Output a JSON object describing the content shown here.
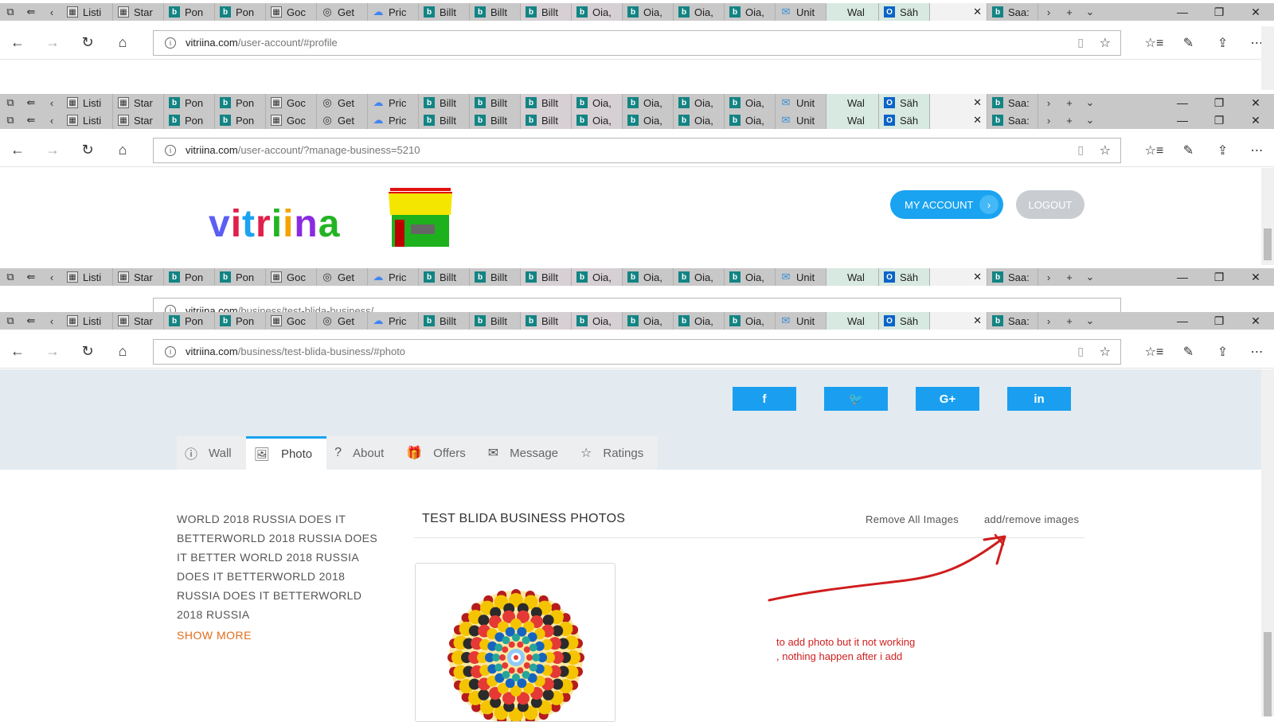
{
  "tabs": [
    {
      "label": "Listi",
      "icon": "tab-list-icon",
      "fav": "grid"
    },
    {
      "label": "Star",
      "icon": "start-page-icon",
      "fav": "grid"
    },
    {
      "label": "Pon",
      "icon": "bing-icon",
      "fav": "bing"
    },
    {
      "label": "Pon",
      "icon": "bing-icon",
      "fav": "bing"
    },
    {
      "label": "Goc",
      "icon": "apps-grid-icon",
      "fav": "grid"
    },
    {
      "label": "Get",
      "icon": "get-icon",
      "fav": "get"
    },
    {
      "label": "Pric",
      "icon": "google-cloud-icon",
      "fav": "gcloud"
    },
    {
      "label": "Billt",
      "icon": "bing-icon",
      "fav": "bing"
    },
    {
      "label": "Billt",
      "icon": "bing-icon",
      "fav": "bing"
    },
    {
      "label": "Billt",
      "icon": "bing-icon",
      "fav": "bing"
    },
    {
      "label": "Oia,",
      "icon": "bing-icon",
      "fav": "bing"
    },
    {
      "label": "Oia,",
      "icon": "bing-icon",
      "fav": "bing"
    },
    {
      "label": "Oia,",
      "icon": "bing-icon",
      "fav": "bing"
    },
    {
      "label": "Oia,",
      "icon": "bing-icon",
      "fav": "bing"
    },
    {
      "label": "Unit",
      "icon": "mail-icon",
      "fav": "mail"
    },
    {
      "label": "Wal",
      "icon": "blank-icon",
      "fav": "none"
    },
    {
      "label": "Säh",
      "icon": "outlook-icon",
      "fav": "outlook"
    },
    {
      "label": "",
      "icon": "active-tab",
      "fav": "active"
    },
    {
      "label": "Saa:",
      "icon": "bing-icon",
      "fav": "bing"
    }
  ],
  "urls": {
    "u1": {
      "domain": "vitriina.com",
      "path": "/user-account/#profile"
    },
    "u2": {
      "domain": "vitriina.com",
      "path": "/user-account/?manage-business=5210"
    },
    "u3": {
      "domain": "vitriina.com",
      "path": "/business/test-blida-business/"
    },
    "u4": {
      "domain": "vitriina.com",
      "path": "/business/test-blida-business/#photo"
    }
  },
  "header": {
    "logo_text": "vitriina",
    "my_account_label": "MY ACCOUNT",
    "logout_label": "LOGOUT"
  },
  "social": [
    {
      "name": "facebook-button",
      "label": "f"
    },
    {
      "name": "twitter-button",
      "label": "🐦"
    },
    {
      "name": "google-plus-button",
      "label": "G+"
    },
    {
      "name": "linkedin-button",
      "label": "in"
    }
  ],
  "page_tabs": [
    {
      "label": "Wall",
      "icon": "ⓘ",
      "name": "tab-wall",
      "selected": false
    },
    {
      "label": "Photo",
      "icon": "🖼",
      "name": "tab-photo",
      "selected": true
    },
    {
      "label": "About",
      "icon": "?",
      "name": "tab-about",
      "selected": false
    },
    {
      "label": "Offers",
      "icon": "🎁",
      "name": "tab-offers",
      "selected": false
    },
    {
      "label": "Message",
      "icon": "✉",
      "name": "tab-message",
      "selected": false
    },
    {
      "label": "Ratings",
      "icon": "☆",
      "name": "tab-ratings",
      "selected": false
    }
  ],
  "sidebar": {
    "description": "WORLD 2018 RUSSIA DOES IT BETTERWORLD 2018 RUSSIA DOES IT BETTER WORLD 2018 RUSSIA DOES IT BETTERWORLD 2018 RUSSIA DOES IT BETTERWORLD 2018 RUSSIA",
    "show_more": "SHOW MORE"
  },
  "photos": {
    "title": "TEST BLIDA BUSINESS PHOTOS",
    "remove_all": "Remove All Images",
    "add_remove": "add/remove images"
  },
  "annotation": {
    "line1": "to add photo but it not working",
    "line2": ", nothing happen after i add"
  },
  "colors": {
    "accent": "#1aa3f0",
    "showmore": "#e36c1a",
    "annotation": "#d02020"
  }
}
